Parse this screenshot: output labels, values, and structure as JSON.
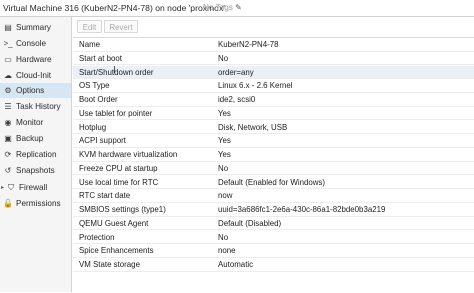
{
  "header": {
    "title": "Virtual Machine 316 (KuberN2-PN4-78) on node 'proxmox'",
    "tags_label": "No Tags",
    "tags_edit_icon": "pencil-icon"
  },
  "sidebar": {
    "items": [
      {
        "label": "Summary",
        "icon": "summary-icon",
        "glyph": "▤"
      },
      {
        "label": "Console",
        "icon": "console-icon",
        "glyph": ">_"
      },
      {
        "label": "Hardware",
        "icon": "hardware-icon",
        "glyph": "▭"
      },
      {
        "label": "Cloud-Init",
        "icon": "cloud-icon",
        "glyph": "☁"
      },
      {
        "label": "Options",
        "icon": "gear-icon",
        "glyph": "⚙",
        "active": true
      },
      {
        "label": "Task History",
        "icon": "list-icon",
        "glyph": "☰"
      },
      {
        "label": "Monitor",
        "icon": "eye-icon",
        "glyph": "◉"
      },
      {
        "label": "Backup",
        "icon": "floppy-icon",
        "glyph": "▣"
      },
      {
        "label": "Replication",
        "icon": "replication-icon",
        "glyph": "⟳"
      },
      {
        "label": "Snapshots",
        "icon": "history-icon",
        "glyph": "↺"
      },
      {
        "label": "Firewall",
        "icon": "shield-icon",
        "glyph": "⛉",
        "has_arrow": true
      },
      {
        "label": "Permissions",
        "icon": "unlock-icon",
        "glyph": "🔓"
      }
    ],
    "firewall_arrow": "▸"
  },
  "toolbar": {
    "edit_label": "Edit",
    "revert_label": "Revert"
  },
  "options": {
    "rows": [
      {
        "key": "Name",
        "value": "KuberN2-PN4-78"
      },
      {
        "key": "Start at boot",
        "value": "No"
      },
      {
        "key": "Start/Shutdown order",
        "value": "order=any",
        "highlight": true
      },
      {
        "key": "OS Type",
        "value": "Linux 6.x - 2.6 Kernel"
      },
      {
        "key": "Boot Order",
        "value": "ide2, scsi0"
      },
      {
        "key": "Use tablet for pointer",
        "value": "Yes"
      },
      {
        "key": "Hotplug",
        "value": "Disk, Network, USB"
      },
      {
        "key": "ACPI support",
        "value": "Yes"
      },
      {
        "key": "KVM hardware virtualization",
        "value": "Yes"
      },
      {
        "key": "Freeze CPU at startup",
        "value": "No"
      },
      {
        "key": "Use local time for RTC",
        "value": "Default (Enabled for Windows)"
      },
      {
        "key": "RTC start date",
        "value": "now"
      },
      {
        "key": "SMBIOS settings (type1)",
        "value": "uuid=3a686fc1-2e6a-430c-86a1-82bde0b3a219"
      },
      {
        "key": "QEMU Guest Agent",
        "value": "Default (Disabled)"
      },
      {
        "key": "Protection",
        "value": "No"
      },
      {
        "key": "Spice Enhancements",
        "value": "none"
      },
      {
        "key": "VM State storage",
        "value": "Automatic"
      }
    ]
  },
  "colors": {
    "selected_nav_bg": "#d6e6f3",
    "hover_row_bg": "#e9f0f7"
  }
}
